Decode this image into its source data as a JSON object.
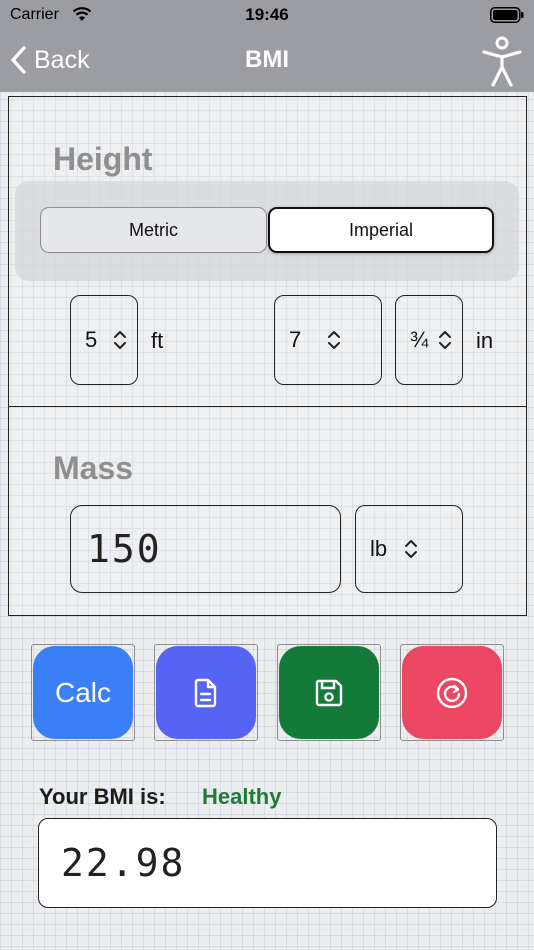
{
  "status_bar": {
    "carrier": "Carrier",
    "time": "19:46"
  },
  "nav": {
    "back_label": "Back",
    "title": "BMI"
  },
  "height": {
    "title": "Height",
    "segments": [
      "Metric",
      "Imperial"
    ],
    "selected_segment": "Imperial",
    "feet_value": "5",
    "feet_unit": "ft",
    "inches_value": "7",
    "fraction_value": "¾",
    "inches_unit": "in"
  },
  "mass": {
    "title": "Mass",
    "value": "150",
    "unit": "lb"
  },
  "actions": {
    "calc_label": "Calc",
    "calc_color": "#3b7ff6",
    "report_color": "#5664f5",
    "save_color": "#137a3a",
    "reset_color": "#eb4662",
    "report_icon": "document-icon",
    "save_icon": "floppy-disk-icon",
    "reset_icon": "refresh-icon"
  },
  "result": {
    "label": "Your BMI is:",
    "status": "Healthy",
    "status_color": "#1f7a3a",
    "value": "22.98"
  }
}
